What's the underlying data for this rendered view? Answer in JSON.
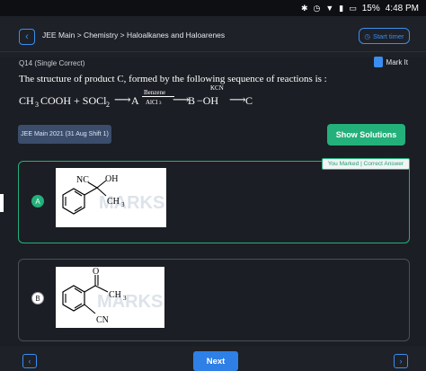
{
  "statusbar": {
    "battery": "15%",
    "time": "4:48 PM"
  },
  "header": {
    "back_icon": "chevron-left-icon",
    "breadcrumb": "JEE Main > Chemistry > Haloalkanes and Haloarenes",
    "timer_label": "Start timer",
    "timer_icon": "clock-icon"
  },
  "question": {
    "number_label": "Q14 (Single Correct)",
    "mark_label": "Mark It",
    "text": "The structure of product C, formed by the following sequence of reactions is :",
    "equation": {
      "reactant1": "CH",
      "sub3": "3",
      "reactant1_tail": "COOH + SOCl",
      "sub2": "2",
      "arrow1": "⟶",
      "A": "A",
      "reagent_top": "Benzene",
      "reagent_bottom": "AlCl",
      "reagent_bottom_sub": "3",
      "B": "B",
      "kcn": "KCN",
      "oh": "−OH",
      "C": "C"
    },
    "tag": "JEE Main 2021 (31 Aug Shift 1)",
    "solutions_label": "Show Solutions"
  },
  "options": [
    {
      "letter": "A",
      "badge": "You Marked | Correct Answer",
      "labels": {
        "nc": "NC",
        "oh": "OH",
        "ch3": "CH",
        "ch3_sub": "3"
      },
      "watermark": "MARKS"
    },
    {
      "letter": "B",
      "labels": {
        "o": "O",
        "ch3": "CH",
        "ch3_sub": "3",
        "cn": "CN"
      },
      "watermark": "MARKS"
    }
  ],
  "footer": {
    "prev_icon": "chevron-left-icon",
    "next_label": "Next",
    "next_icon": "chevron-right-icon"
  },
  "colors": {
    "accent": "#3a8ef0",
    "success": "#23b07a",
    "background": "#1b1e24"
  }
}
